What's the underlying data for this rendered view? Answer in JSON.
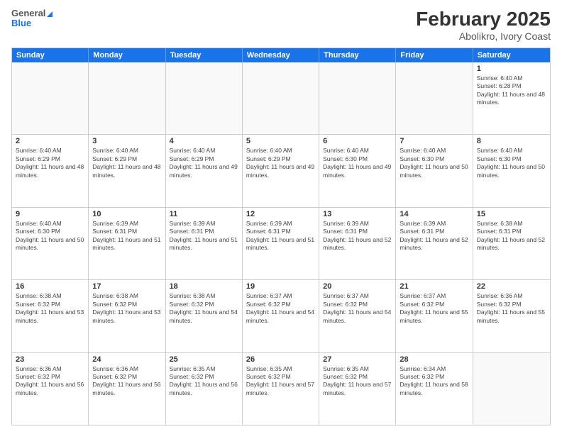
{
  "header": {
    "logo_general": "General",
    "logo_blue": "Blue",
    "month_year": "February 2025",
    "location": "Abolikro, Ivory Coast"
  },
  "days_of_week": [
    "Sunday",
    "Monday",
    "Tuesday",
    "Wednesday",
    "Thursday",
    "Friday",
    "Saturday"
  ],
  "weeks": [
    [
      {
        "day": "",
        "info": ""
      },
      {
        "day": "",
        "info": ""
      },
      {
        "day": "",
        "info": ""
      },
      {
        "day": "",
        "info": ""
      },
      {
        "day": "",
        "info": ""
      },
      {
        "day": "",
        "info": ""
      },
      {
        "day": "1",
        "info": "Sunrise: 6:40 AM\nSunset: 6:28 PM\nDaylight: 11 hours and 48 minutes."
      }
    ],
    [
      {
        "day": "2",
        "info": "Sunrise: 6:40 AM\nSunset: 6:29 PM\nDaylight: 11 hours and 48 minutes."
      },
      {
        "day": "3",
        "info": "Sunrise: 6:40 AM\nSunset: 6:29 PM\nDaylight: 11 hours and 48 minutes."
      },
      {
        "day": "4",
        "info": "Sunrise: 6:40 AM\nSunset: 6:29 PM\nDaylight: 11 hours and 49 minutes."
      },
      {
        "day": "5",
        "info": "Sunrise: 6:40 AM\nSunset: 6:29 PM\nDaylight: 11 hours and 49 minutes."
      },
      {
        "day": "6",
        "info": "Sunrise: 6:40 AM\nSunset: 6:30 PM\nDaylight: 11 hours and 49 minutes."
      },
      {
        "day": "7",
        "info": "Sunrise: 6:40 AM\nSunset: 6:30 PM\nDaylight: 11 hours and 50 minutes."
      },
      {
        "day": "8",
        "info": "Sunrise: 6:40 AM\nSunset: 6:30 PM\nDaylight: 11 hours and 50 minutes."
      }
    ],
    [
      {
        "day": "9",
        "info": "Sunrise: 6:40 AM\nSunset: 6:30 PM\nDaylight: 11 hours and 50 minutes."
      },
      {
        "day": "10",
        "info": "Sunrise: 6:39 AM\nSunset: 6:31 PM\nDaylight: 11 hours and 51 minutes."
      },
      {
        "day": "11",
        "info": "Sunrise: 6:39 AM\nSunset: 6:31 PM\nDaylight: 11 hours and 51 minutes."
      },
      {
        "day": "12",
        "info": "Sunrise: 6:39 AM\nSunset: 6:31 PM\nDaylight: 11 hours and 51 minutes."
      },
      {
        "day": "13",
        "info": "Sunrise: 6:39 AM\nSunset: 6:31 PM\nDaylight: 11 hours and 52 minutes."
      },
      {
        "day": "14",
        "info": "Sunrise: 6:39 AM\nSunset: 6:31 PM\nDaylight: 11 hours and 52 minutes."
      },
      {
        "day": "15",
        "info": "Sunrise: 6:38 AM\nSunset: 6:31 PM\nDaylight: 11 hours and 52 minutes."
      }
    ],
    [
      {
        "day": "16",
        "info": "Sunrise: 6:38 AM\nSunset: 6:32 PM\nDaylight: 11 hours and 53 minutes."
      },
      {
        "day": "17",
        "info": "Sunrise: 6:38 AM\nSunset: 6:32 PM\nDaylight: 11 hours and 53 minutes."
      },
      {
        "day": "18",
        "info": "Sunrise: 6:38 AM\nSunset: 6:32 PM\nDaylight: 11 hours and 54 minutes."
      },
      {
        "day": "19",
        "info": "Sunrise: 6:37 AM\nSunset: 6:32 PM\nDaylight: 11 hours and 54 minutes."
      },
      {
        "day": "20",
        "info": "Sunrise: 6:37 AM\nSunset: 6:32 PM\nDaylight: 11 hours and 54 minutes."
      },
      {
        "day": "21",
        "info": "Sunrise: 6:37 AM\nSunset: 6:32 PM\nDaylight: 11 hours and 55 minutes."
      },
      {
        "day": "22",
        "info": "Sunrise: 6:36 AM\nSunset: 6:32 PM\nDaylight: 11 hours and 55 minutes."
      }
    ],
    [
      {
        "day": "23",
        "info": "Sunrise: 6:36 AM\nSunset: 6:32 PM\nDaylight: 11 hours and 56 minutes."
      },
      {
        "day": "24",
        "info": "Sunrise: 6:36 AM\nSunset: 6:32 PM\nDaylight: 11 hours and 56 minutes."
      },
      {
        "day": "25",
        "info": "Sunrise: 6:35 AM\nSunset: 6:32 PM\nDaylight: 11 hours and 56 minutes."
      },
      {
        "day": "26",
        "info": "Sunrise: 6:35 AM\nSunset: 6:32 PM\nDaylight: 11 hours and 57 minutes."
      },
      {
        "day": "27",
        "info": "Sunrise: 6:35 AM\nSunset: 6:32 PM\nDaylight: 11 hours and 57 minutes."
      },
      {
        "day": "28",
        "info": "Sunrise: 6:34 AM\nSunset: 6:32 PM\nDaylight: 11 hours and 58 minutes."
      },
      {
        "day": "",
        "info": ""
      }
    ]
  ]
}
